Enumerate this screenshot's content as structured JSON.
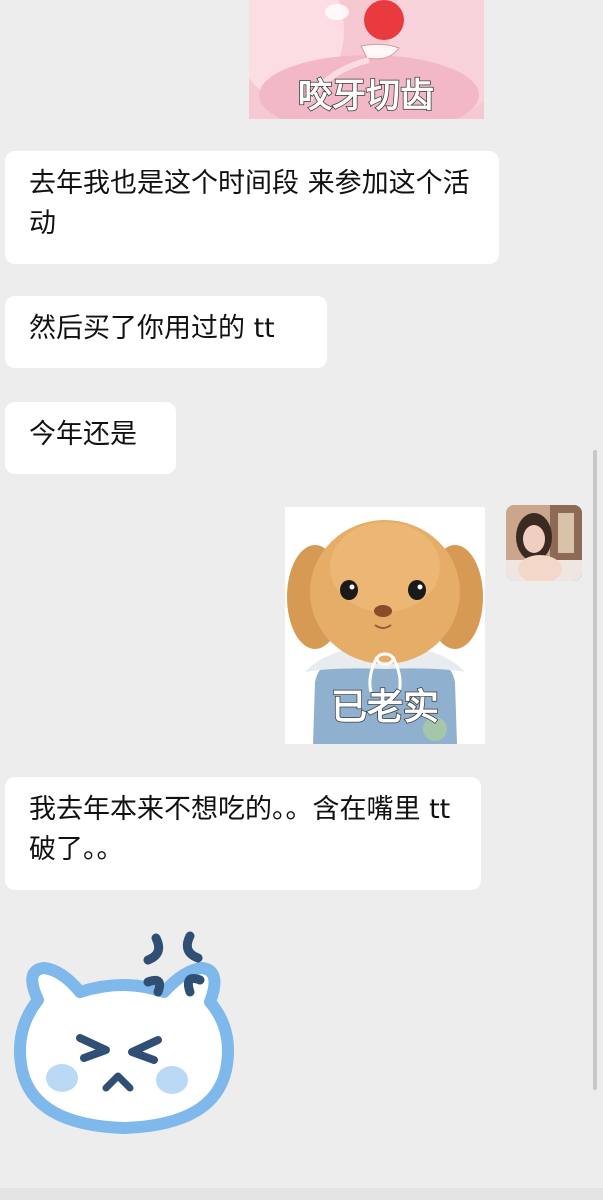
{
  "messages": [
    {
      "side": "left",
      "type": "sticker",
      "sticker": "pink-plush-teeth",
      "caption": "咬牙切齿"
    },
    {
      "side": "left",
      "type": "text",
      "text": "去年我也是这个时间段 来参加这个活动"
    },
    {
      "side": "left",
      "type": "text",
      "text": "然后买了你用过的 tt"
    },
    {
      "side": "left",
      "type": "text",
      "text": "今年还是"
    },
    {
      "side": "right",
      "type": "sticker",
      "sticker": "plush-puppy",
      "caption": "已老实"
    },
    {
      "side": "left",
      "type": "text",
      "text": "我去年本来不想吃的。。含在嘴里 tt 破了。。"
    },
    {
      "side": "left",
      "type": "sticker",
      "sticker": "angry-blue-cat"
    }
  ],
  "colors": {
    "background": "#ededed",
    "bubble": "#ffffff",
    "text": "#111111",
    "angry_blue": "#7fb8ea",
    "angry_dark": "#2f4f74"
  }
}
